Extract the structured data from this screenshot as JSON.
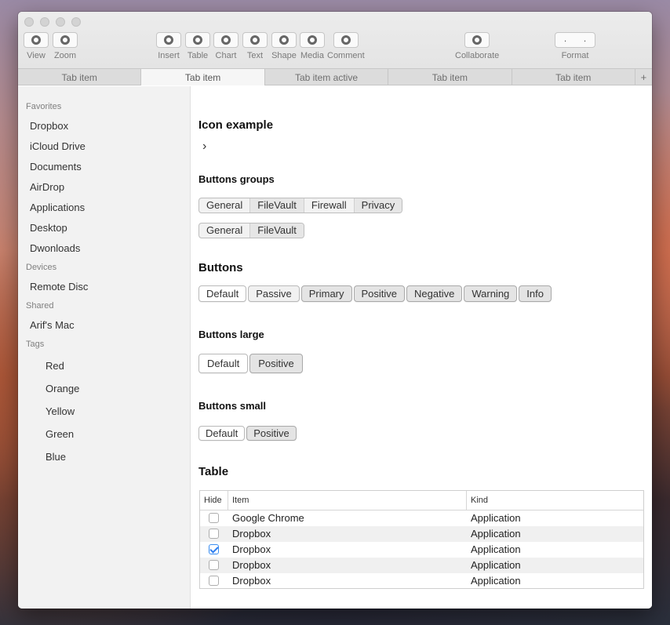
{
  "toolbar": {
    "left_tools": [
      {
        "label": "View"
      },
      {
        "label": "Zoom"
      }
    ],
    "middle_tools": [
      {
        "label": "Insert"
      },
      {
        "label": "Table"
      },
      {
        "label": "Chart"
      },
      {
        "label": "Text"
      },
      {
        "label": "Shape"
      },
      {
        "label": "Media"
      },
      {
        "label": "Comment"
      }
    ],
    "collaborate_label": "Collaborate",
    "format_label": "Format",
    "format_dots": [
      ".",
      "."
    ]
  },
  "tabs": [
    "Tab item",
    "Tab item",
    "Tab item active",
    "Tab item",
    "Tab item"
  ],
  "tab_add": "+",
  "sidebar": {
    "favorites_heading": "Favorites",
    "favorites": [
      "Dropbox",
      "iCloud Drive",
      "Documents",
      "AirDrop",
      "Applications",
      "Desktop",
      "Dwonloads"
    ],
    "devices_heading": "Devices",
    "devices": [
      "Remote Disc"
    ],
    "shared_heading": "Shared",
    "shared": [
      "Arif's Mac"
    ],
    "tags_heading": "Tags",
    "tags": [
      "Red",
      "Orange",
      "Yellow",
      "Green",
      "Blue"
    ]
  },
  "content": {
    "icon_example_title": "Icon example",
    "icon_glyph": "›",
    "button_groups_title": "Buttons groups",
    "group1": [
      "General",
      "FileVault",
      "Firewall",
      "Privacy"
    ],
    "group2": [
      "General",
      "FileVault"
    ],
    "buttons_title": "Buttons",
    "buttons": [
      "Default",
      "Passive",
      "Primary",
      "Positive",
      "Negative",
      "Warning",
      "Info"
    ],
    "buttons_large_title": "Buttons large",
    "buttons_large": [
      "Default",
      "Positive"
    ],
    "buttons_small_title": "Buttons small",
    "buttons_small": [
      "Default",
      "Positive"
    ],
    "table_title": "Table",
    "table": {
      "headers": [
        "Hide",
        "Item",
        "Kind"
      ],
      "rows": [
        {
          "checked": false,
          "item": "Google Chrome",
          "kind": "Application"
        },
        {
          "checked": false,
          "item": "Dropbox",
          "kind": "Application"
        },
        {
          "checked": true,
          "item": "Dropbox",
          "kind": "Application"
        },
        {
          "checked": false,
          "item": "Dropbox",
          "kind": "Application"
        },
        {
          "checked": false,
          "item": "Dropbox",
          "kind": "Application"
        }
      ]
    }
  }
}
